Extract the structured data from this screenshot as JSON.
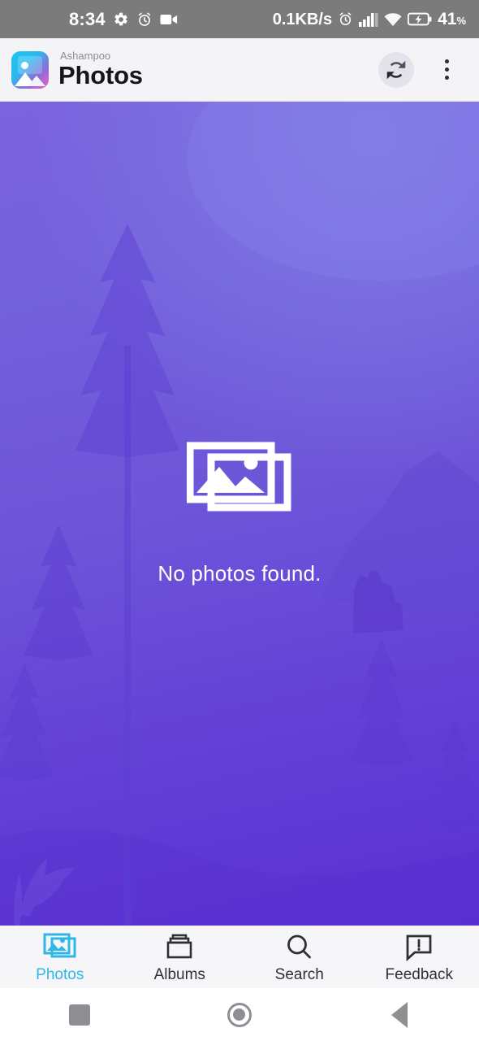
{
  "statusbar": {
    "time": "8:34",
    "left_icons": [
      "gear-icon",
      "alarm-clock-icon",
      "video-camera-icon"
    ],
    "network_speed": "0.1KB/s",
    "right_icons": [
      "alarm-clock-icon",
      "signal-bars-icon",
      "wifi-icon",
      "battery-charging-icon"
    ],
    "battery_level": "41",
    "battery_unit": "%",
    "background_color": "#7b7b7b"
  },
  "appbar": {
    "brand": "Ashampoo",
    "title": "Photos",
    "logo_icon": "ashampoo-photos-logo",
    "refresh_icon": "refresh-icon",
    "overflow_icon": "overflow-menu-icon",
    "background_color": "#f4f4f6",
    "title_color": "#15151a"
  },
  "content": {
    "empty_icon": "photo-stack-icon",
    "empty_message": "No photos found.",
    "background_description": "purple-tinted forest landscape",
    "accent_color": "#6d55d8"
  },
  "bottomnav": {
    "active_color": "#2fb6e8",
    "inactive_color": "#2f2f36",
    "items": [
      {
        "label": "Photos",
        "icon": "photo-stack-icon",
        "active": true
      },
      {
        "label": "Albums",
        "icon": "album-box-icon",
        "active": false
      },
      {
        "label": "Search",
        "icon": "search-icon",
        "active": false
      },
      {
        "label": "Feedback",
        "icon": "feedback-icon",
        "active": false
      }
    ]
  },
  "sysnav": {
    "recents_label": "Recents",
    "home_label": "Home",
    "back_label": "Back"
  }
}
